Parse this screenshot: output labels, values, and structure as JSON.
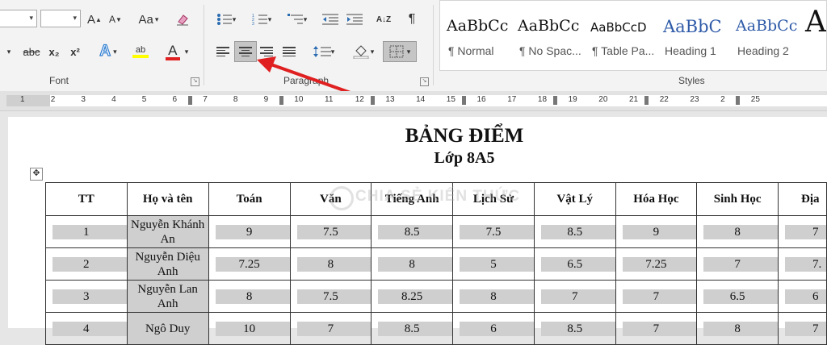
{
  "ribbon": {
    "font_group": {
      "label": "Font"
    },
    "paragraph_group": {
      "label": "Paragraph"
    },
    "styles_group": {
      "label": "Styles",
      "items": [
        {
          "sample": "AaBbCc",
          "name": "¶ Normal"
        },
        {
          "sample": "AaBbCc",
          "name": "¶ No Spac..."
        },
        {
          "sample": "AaBbCcD",
          "name": "¶ Table Pa..."
        },
        {
          "sample": "AaBbC",
          "name": "Heading 1"
        },
        {
          "sample": "AaBbCc",
          "name": "Heading 2"
        },
        {
          "sample": "A",
          "name": ""
        }
      ]
    },
    "buttons": {
      "grow_font": "A",
      "shrink_font": "A",
      "change_case": "Aa",
      "strikethrough": "abc",
      "subscript": "x₂",
      "superscript": "x²",
      "text_effects": "A",
      "highlight": "ab",
      "font_color": "A",
      "pilcrow": "¶",
      "sort": "A↓Z"
    }
  },
  "ruler": {
    "ticks": [
      "1",
      "2",
      "3",
      "4",
      "5",
      "6",
      "7",
      "8",
      "9",
      "10",
      "11",
      "12",
      "13",
      "14",
      "15",
      "16",
      "17",
      "18",
      "19",
      "20",
      "21",
      "22",
      "23",
      "2",
      "25"
    ]
  },
  "document": {
    "title": "BẢNG ĐIỂM",
    "subtitle": "Lớp 8A5",
    "watermark": "CHIA SẺ KIẾN THỨC",
    "table": {
      "headers": [
        "TT",
        "Họ và tên",
        "Toán",
        "Văn",
        "Tiếng Anh",
        "Lịch Sử",
        "Vật Lý",
        "Hóa Học",
        "Sinh Học",
        "Địa"
      ],
      "rows": [
        [
          "1",
          "Nguyễn Khánh An",
          "9",
          "7.5",
          "8.5",
          "7.5",
          "8.5",
          "9",
          "8",
          "7"
        ],
        [
          "2",
          "Nguyễn Diệu Anh",
          "7.25",
          "8",
          "8",
          "5",
          "6.5",
          "7.25",
          "7",
          "7."
        ],
        [
          "3",
          "Nguyễn Lan Anh",
          "8",
          "7.5",
          "8.25",
          "8",
          "7",
          "7",
          "6.5",
          "6"
        ],
        [
          "4",
          "Ngô Duy",
          "10",
          "7",
          "8.5",
          "6",
          "8.5",
          "7",
          "8",
          "7"
        ]
      ]
    }
  },
  "colors": {
    "arrow": "#e02020",
    "highlight_yellow": "#ffff00",
    "font_red": "#e02020",
    "selection_gray": "#cfcfcf"
  }
}
